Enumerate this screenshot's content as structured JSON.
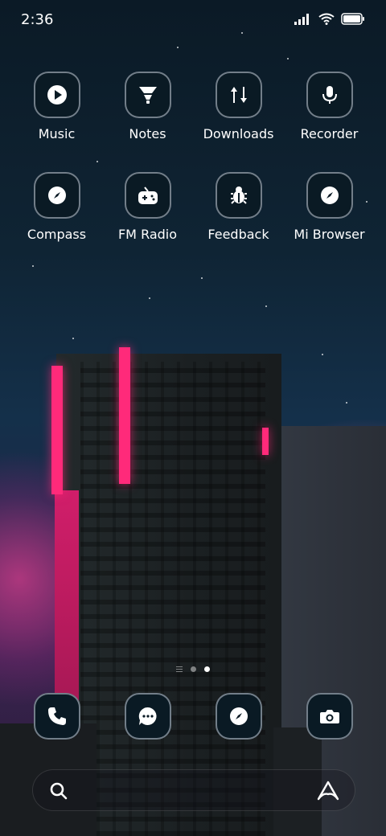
{
  "status_bar": {
    "time": "2:36"
  },
  "apps_row1": [
    {
      "label": "Music",
      "icon": "play-icon"
    },
    {
      "label": "Notes",
      "icon": "notes-icon"
    },
    {
      "label": "Downloads",
      "icon": "downloads-icon"
    },
    {
      "label": "Recorder",
      "icon": "microphone-icon"
    }
  ],
  "apps_row2": [
    {
      "label": "Compass",
      "icon": "compass-icon"
    },
    {
      "label": "FM Radio",
      "icon": "gamepad-icon"
    },
    {
      "label": "Feedback",
      "icon": "bug-icon"
    },
    {
      "label": "Mi Browser",
      "icon": "compass-icon"
    }
  ],
  "page_indicator": {
    "pages": 2,
    "active": 2
  },
  "dock": [
    {
      "name": "phone",
      "icon": "phone-icon"
    },
    {
      "name": "messages",
      "icon": "chat-icon"
    },
    {
      "name": "browser",
      "icon": "compass-icon"
    },
    {
      "name": "camera",
      "icon": "camera-icon"
    }
  ],
  "search_bar": {
    "left_icon": "search-icon",
    "right_icon": "assistant-icon"
  },
  "colors": {
    "neon": "#ff2a7a",
    "icon_bg": "#0a1a24",
    "icon_border": "#c8d2dc"
  }
}
